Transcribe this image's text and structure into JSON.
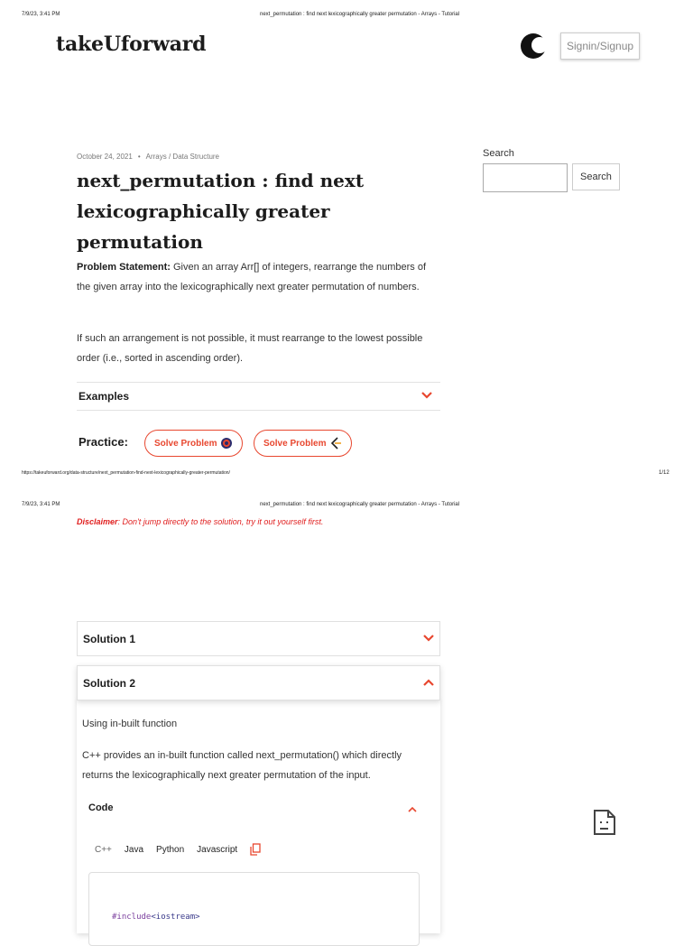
{
  "print_header_1": {
    "timestamp": "7/9/23, 3:41 PM",
    "doc_title": "next_permutation : find next lexicographically greater permutation - Arrays - Tutorial"
  },
  "print_footer_1": {
    "url": "https://takeuforward.org/data-structure/next_permutation-find-next-lexicographically-greater-permutation/",
    "page": "1/12"
  },
  "print_header_2": {
    "timestamp": "7/9/23, 3:41 PM",
    "doc_title": "next_permutation : find next lexicographically greater permutation - Arrays - Tutorial"
  },
  "header": {
    "logo": "takeUforward",
    "signin_label": "Signin/Signup",
    "theme_icon": "moon-icon"
  },
  "article": {
    "date": "October 24, 2021",
    "bullet": "•",
    "category": "Arrays / Data Structure",
    "title": "next_permutation : find next lexicographically greater permutation",
    "problem_label": "Problem Statement:",
    "problem_text": " Given an array Arr[] of integers, rearrange the numbers of the given array into the lexicographically next greater permutation of numbers.",
    "note": "If such an arrangement is not possible, it must rearrange to the lowest possible order (i.e., sorted in ascending order).",
    "examples_label": "Examples",
    "practice_label": "Practice:",
    "solve_label_1": "Solve Problem",
    "solve_label_2": "Solve Problem"
  },
  "sidebar": {
    "search_label": "Search",
    "search_value": "",
    "search_button": "Search"
  },
  "disclaimer": {
    "label": "Disclaimer",
    "text": ": Don't jump directly to the solution, try it out yourself first."
  },
  "solution1": {
    "label": "Solution 1"
  },
  "solution2": {
    "label": "Solution 2",
    "intro": "Using in-built function",
    "description": "C++ provides an in-built function called next_permutation() which directly returns the lexicographically next greater permutation of the input.",
    "code_label": "Code",
    "tabs": [
      "C++",
      "Java",
      "Python",
      "Javascript"
    ],
    "code_line_1_kw": "#include",
    "code_line_1_hdr": "<iostream>"
  },
  "colors": {
    "accent": "#e8472f",
    "disclaimer": "#e01e1e"
  },
  "icons": {
    "broken_image": "broken-image-icon",
    "copy": "copy-icon",
    "chevron_down": "chevron-down-icon",
    "chevron_up": "chevron-up-icon"
  }
}
